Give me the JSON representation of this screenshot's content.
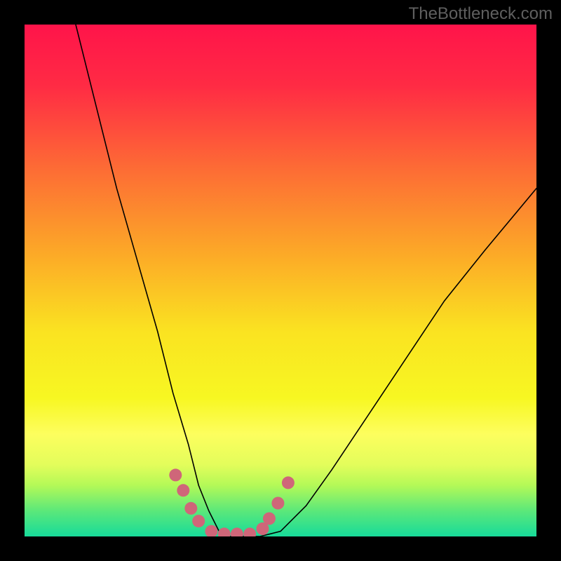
{
  "watermark": "TheBottleneck.com",
  "gradient": {
    "stops": [
      {
        "offset": 0.0,
        "color": "#ff144a"
      },
      {
        "offset": 0.12,
        "color": "#ff2b44"
      },
      {
        "offset": 0.28,
        "color": "#fd6b35"
      },
      {
        "offset": 0.45,
        "color": "#fcaa27"
      },
      {
        "offset": 0.6,
        "color": "#fae321"
      },
      {
        "offset": 0.73,
        "color": "#f7f722"
      },
      {
        "offset": 0.8,
        "color": "#fdfe5e"
      },
      {
        "offset": 0.86,
        "color": "#e3fd5b"
      },
      {
        "offset": 0.9,
        "color": "#b4f957"
      },
      {
        "offset": 0.95,
        "color": "#5be87a"
      },
      {
        "offset": 1.0,
        "color": "#17db9a"
      }
    ]
  },
  "chart_data": {
    "type": "line",
    "title": "",
    "xlabel": "",
    "ylabel": "",
    "xlim": [
      0,
      100
    ],
    "ylim": [
      0,
      100
    ],
    "series": [
      {
        "name": "bottleneck-curve",
        "x": [
          10,
          14,
          18,
          22,
          26,
          29,
          32,
          34,
          36,
          38,
          40,
          43,
          46,
          50,
          55,
          60,
          66,
          74,
          82,
          90,
          100
        ],
        "y": [
          100,
          84,
          68,
          54,
          40,
          28,
          18,
          10,
          5,
          1,
          0,
          0,
          0,
          1,
          6,
          13,
          22,
          34,
          46,
          56,
          68
        ]
      }
    ],
    "markers": {
      "name": "valley-dots",
      "color": "#cf6679",
      "x": [
        29.5,
        31.0,
        32.5,
        34.0,
        36.5,
        39.0,
        41.5,
        44.0,
        46.5,
        47.8,
        49.5,
        51.5
      ],
      "y": [
        12.0,
        9.0,
        5.5,
        3.0,
        1.0,
        0.5,
        0.5,
        0.5,
        1.5,
        3.5,
        6.5,
        10.5
      ]
    }
  }
}
